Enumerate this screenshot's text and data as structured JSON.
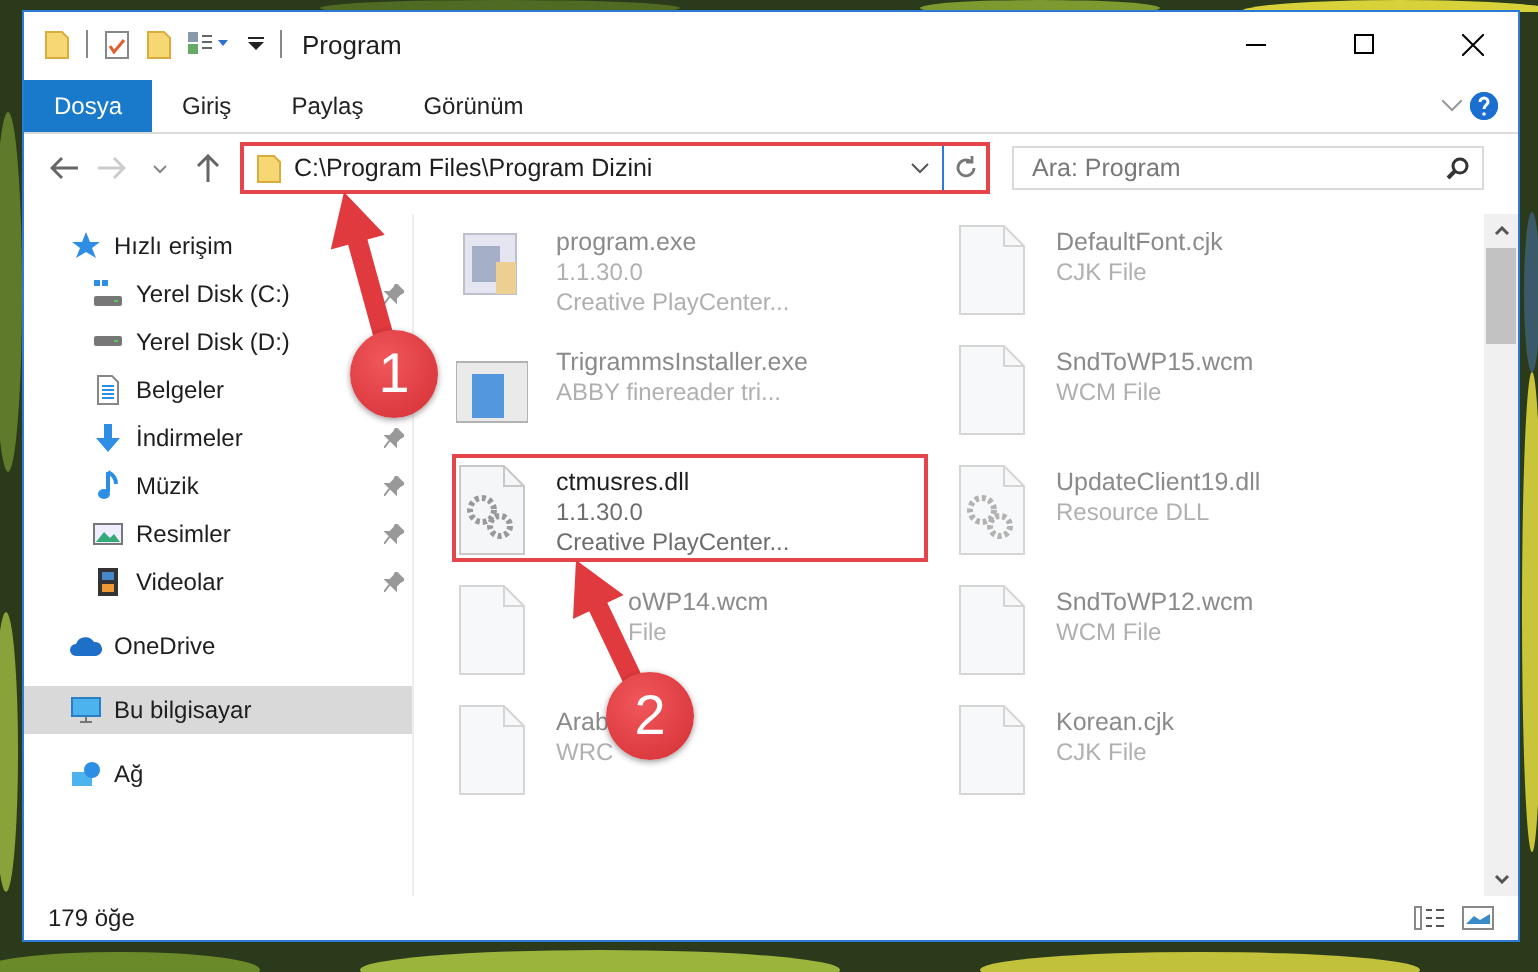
{
  "window": {
    "title": "Program"
  },
  "ribbon_tabs": [
    {
      "label": "Dosya",
      "selected": true
    },
    {
      "label": "Giriş",
      "selected": false
    },
    {
      "label": "Paylaş",
      "selected": false
    },
    {
      "label": "Görünüm",
      "selected": false
    }
  ],
  "address_bar": {
    "path": "C:\\Program Files\\Program Dizini",
    "highlighted": true
  },
  "search": {
    "placeholder": "Ara: Program"
  },
  "sidebar": {
    "items": [
      {
        "label": "Hızlı erişim",
        "kind": "quick-access",
        "selected": false,
        "children": [
          {
            "label": "Yerel Disk (C:)",
            "kind": "drive-system",
            "pinned": true,
            "selected": false
          },
          {
            "label": "Yerel Disk (D:)",
            "kind": "drive",
            "selected": false
          },
          {
            "label": "Belgeler",
            "kind": "documents",
            "selected": false
          },
          {
            "label": "İndirmeler",
            "kind": "downloads",
            "pinned": true,
            "selected": false
          },
          {
            "label": "Müzik",
            "kind": "music",
            "pinned": true,
            "selected": false
          },
          {
            "label": "Resimler",
            "kind": "pictures",
            "pinned": true,
            "selected": false
          },
          {
            "label": "Videolar",
            "kind": "videos",
            "pinned": true,
            "selected": false
          }
        ]
      },
      {
        "label": "OneDrive",
        "kind": "cloud",
        "selected": false
      },
      {
        "label": "Bu bilgisayar",
        "kind": "computer",
        "selected": true
      },
      {
        "label": "Ağ",
        "kind": "network",
        "selected": false
      }
    ]
  },
  "files": [
    {
      "kind": "exe",
      "name": "program.exe",
      "lines": [
        "1.1.30.0",
        "Creative PlayCenter..."
      ],
      "highlighted": false,
      "blurred": true
    },
    {
      "kind": "blank",
      "name": "DefaultFont.cjk",
      "lines": [
        "CJK File"
      ],
      "highlighted": false,
      "blurred": true
    },
    {
      "kind": "installer",
      "name": "TrigrammsInstaller.exe",
      "lines": [
        "ABBY finereader tri..."
      ],
      "highlighted": false,
      "blurred": true
    },
    {
      "kind": "blank",
      "name": "SndToWP15.wcm",
      "lines": [
        "WCM File"
      ],
      "highlighted": false,
      "blurred": true
    },
    {
      "kind": "dll",
      "name": "ctmusres.dll",
      "lines": [
        "1.1.30.0",
        "Creative PlayCenter..."
      ],
      "highlighted": true,
      "blurred": false
    },
    {
      "kind": "dll",
      "name": "UpdateClient19.dll",
      "lines": [
        "Resource DLL"
      ],
      "highlighted": false,
      "blurred": true
    },
    {
      "kind": "blank",
      "name": "oWP14.wcm",
      "lines": [
        "File"
      ],
      "highlighted": false,
      "blurred": true,
      "covered_start": true
    },
    {
      "kind": "blank",
      "name": "SndToWP12.wcm",
      "lines": [
        "WCM File"
      ],
      "highlighted": false,
      "blurred": true
    },
    {
      "kind": "blank",
      "name": "Arab",
      "lines": [
        "WRC"
      ],
      "highlighted": false,
      "blurred": true
    },
    {
      "kind": "blank",
      "name": "Korean.cjk",
      "lines": [
        "CJK File"
      ],
      "highlighted": false,
      "blurred": true
    }
  ],
  "status_bar": {
    "item_count": "179 öğe"
  },
  "annotations": [
    {
      "number": "1"
    },
    {
      "number": "2"
    }
  ]
}
